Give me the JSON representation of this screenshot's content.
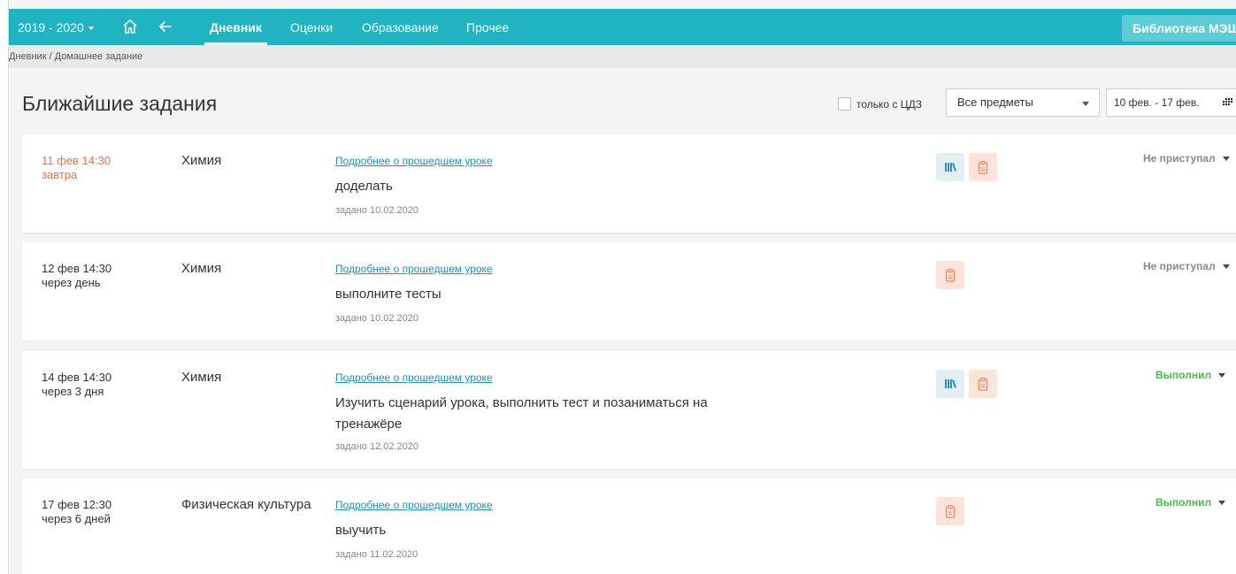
{
  "topbar": {
    "year": "2019 - 2020",
    "nav": [
      "Дневник",
      "Оценки",
      "Образование",
      "Прочее"
    ],
    "library_button": "Библиотека МЭШ"
  },
  "breadcrumb": "Дневник / Домашнее задание",
  "page_title": "Ближайшие задания",
  "filters": {
    "cdz_label": "только с ЦДЗ",
    "subject_selected": "Все предметы",
    "date_range": "10 фев. - 17 фев."
  },
  "assignments": [
    {
      "date": "11 фев 14:30",
      "relative": "завтра",
      "subject": "Химия",
      "lesson_link": "Подробнее о прошедшем уроке",
      "task": "доделать",
      "assigned": "задано 10.02.2020",
      "icons": [
        "library-icon",
        "clipboard-icon"
      ],
      "status": "Не приступал"
    },
    {
      "date": "12 фев 14:30",
      "relative": "через день",
      "subject": "Химия",
      "lesson_link": "Подробнее о прошедшем уроке",
      "task": "выполните тесты",
      "assigned": "задано 10.02.2020",
      "icons": [
        "clipboard-icon"
      ],
      "status": "Не приступал"
    },
    {
      "date": "14 фев 14:30",
      "relative": "через 3 дня",
      "subject": "Химия",
      "lesson_link": "Подробнее о прошедшем уроке",
      "task": "Изучить сценарий урока, выполнить тест и позаниматься на тренажёре",
      "assigned": "задано 12.02.2020",
      "icons": [
        "library-icon",
        "clipboard-icon"
      ],
      "status": "Выполнил"
    },
    {
      "date": "17 фев 12:30",
      "relative": "через 6 дней",
      "subject": "Физическая культура",
      "lesson_link": "Подробнее о прошедшем уроке",
      "task": "выучить",
      "assigned": "задано 11.02.2020",
      "icons": [
        "clipboard-icon"
      ],
      "status": "Выполнил"
    }
  ],
  "colors": {
    "header": "#20b3c1",
    "urgent_date": "#f46e40",
    "link": "#1e8fc8",
    "status_not_started": "#8a8a8a",
    "status_done": "#48b949"
  }
}
